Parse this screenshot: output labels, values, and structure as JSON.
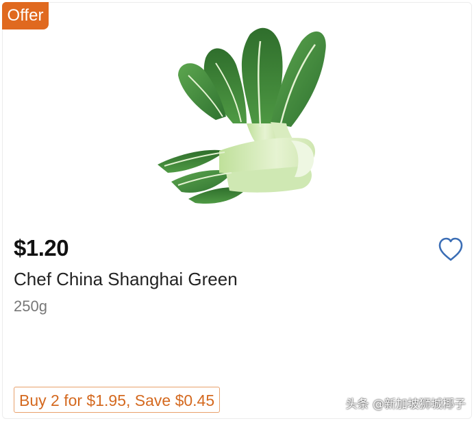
{
  "badge": {
    "label": "Offer",
    "color": "#e0691f"
  },
  "product": {
    "image_icon": "pak-choi-image",
    "price": "$1.20",
    "name": "Chef China Shanghai Green",
    "size": "250g",
    "wishlist_icon": "heart-outline-icon"
  },
  "promotion": {
    "label": "Buy 2 for $1.95, Save $0.45",
    "color": "#d4691f"
  },
  "watermark": {
    "text": "头条 @新加坡狮城椰子"
  },
  "colors": {
    "accent": "#e0691f",
    "heart": "#3a6db5",
    "leaf": "#3f8a3a"
  }
}
